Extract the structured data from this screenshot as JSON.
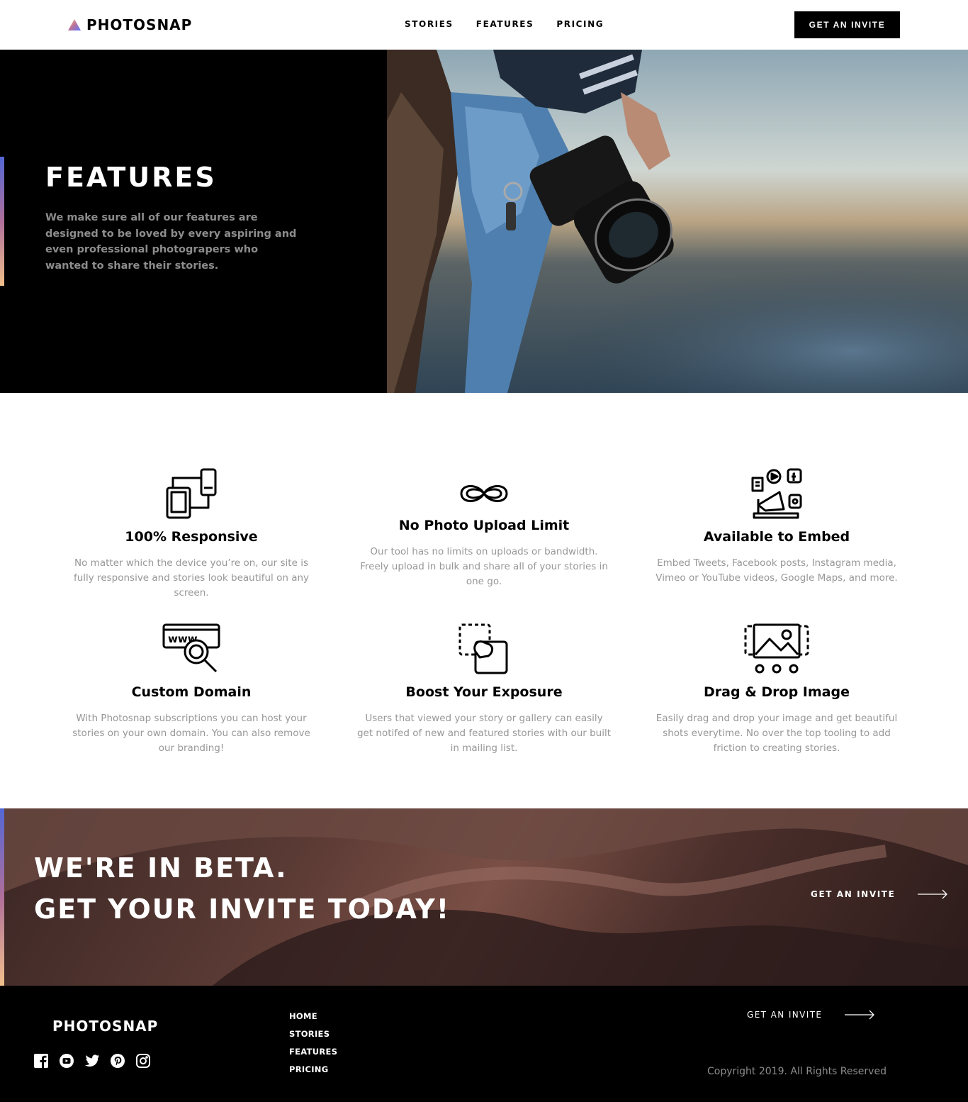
{
  "header": {
    "logo_text": "PHOTOSNAP",
    "nav": [
      "STORIES",
      "FEATURES",
      "PRICING"
    ],
    "cta_label": "GET AN INVITE"
  },
  "hero": {
    "title": "FEATURES",
    "description": "We make sure all of our features are designed to be loved by every aspiring and even professional photograpers who wanted to share their stories."
  },
  "features": [
    {
      "icon": "responsive-devices-icon",
      "title": "100% Responsive",
      "text": "No matter which the device you’re on, our site is fully responsive and stories look beautiful on any screen."
    },
    {
      "icon": "infinity-icon",
      "title": "No Photo Upload Limit",
      "text": "Our tool has no limits on uploads or bandwidth. Freely upload in bulk and share all of your stories in one go."
    },
    {
      "icon": "embed-megaphone-icon",
      "title": "Available to Embed",
      "text": "Embed Tweets, Facebook posts, Instagram media, Vimeo or YouTube videos, Google Maps, and more."
    },
    {
      "icon": "www-search-icon",
      "title": "Custom Domain",
      "text": "With Photosnap subscriptions you can host your stories on your own domain. You can also remove our branding!"
    },
    {
      "icon": "boost-hand-icon",
      "title": "Boost Your Exposure",
      "text": "Users that viewed your story or gallery can easily get notifed of new and featured stories with our built in mailing list."
    },
    {
      "icon": "drag-drop-image-icon",
      "title": "Drag & Drop Image",
      "text": "Easily drag and drop your image and get beautiful shots everytime. No over the top tooling to add friction to creating stories."
    }
  ],
  "beta": {
    "line1": "WE'RE IN BETA.",
    "line2": "GET YOUR INVITE TODAY!",
    "link": "GET AN INVITE"
  },
  "footer": {
    "logo_text": "PHOTOSNAP",
    "socials": [
      "facebook-icon",
      "youtube-icon",
      "twitter-icon",
      "pinterest-icon",
      "instagram-icon"
    ],
    "nav": [
      "HOME",
      "STORIES",
      "FEATURES",
      "PRICING"
    ],
    "invite": "GET AN INVITE",
    "copyright": "Copyright 2019. All Rights Reserved"
  }
}
